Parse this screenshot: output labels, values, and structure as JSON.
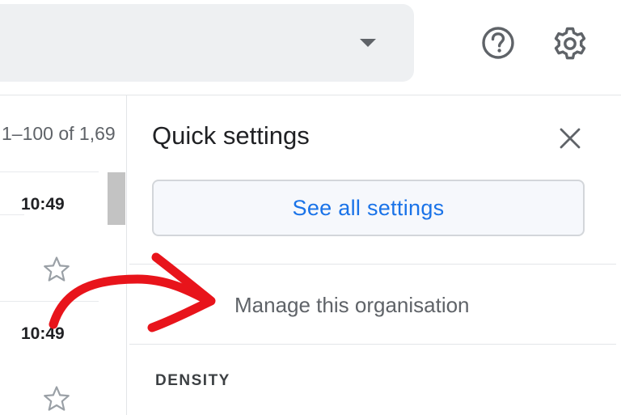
{
  "topbar": {
    "search_dropdown_icon": "caret-down-icon",
    "help_icon": "help-circle-icon",
    "settings_icon": "gear-icon"
  },
  "mail_list": {
    "pagination": "1–100 of 1,69",
    "rows": [
      {
        "time": "10:49",
        "starred": false
      },
      {
        "time": "10:49",
        "starred": false
      }
    ]
  },
  "quick_settings": {
    "title": "Quick settings",
    "close_icon": "close-icon",
    "see_all_label": "See all settings",
    "manage_org_label": "Manage this organisation",
    "density_heading": "DENSITY"
  },
  "colors": {
    "accent_blue": "#1a73e8",
    "annotation_red": "#e8141b",
    "search_bg": "#eef0f2"
  }
}
